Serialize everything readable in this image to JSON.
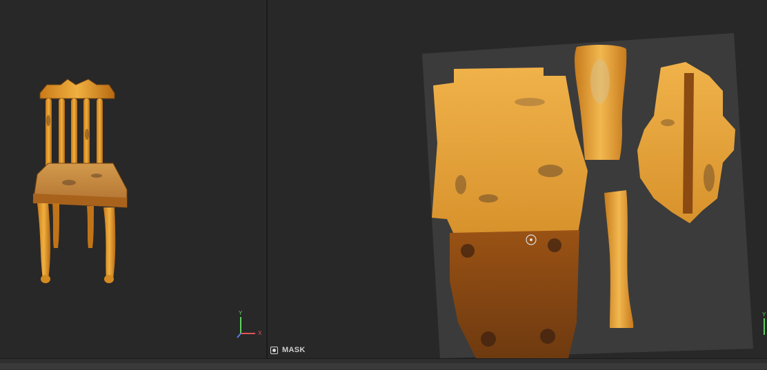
{
  "viewport_3d": {
    "object": "chair-model",
    "axis_gizmo": {
      "y_label": "Y",
      "x_label": "X"
    }
  },
  "viewport_2d": {
    "mask_label": "MASK",
    "axis_gizmo": {
      "y_label": "Y"
    }
  },
  "colors": {
    "background": "#282828",
    "wood_light": "#e8a532",
    "wood_dark": "#8a4a12",
    "uv_sheet": "#3b3b3b",
    "axis_y": "#5fd35f",
    "axis_x": "#e05555",
    "axis_z": "#5a7be0"
  }
}
